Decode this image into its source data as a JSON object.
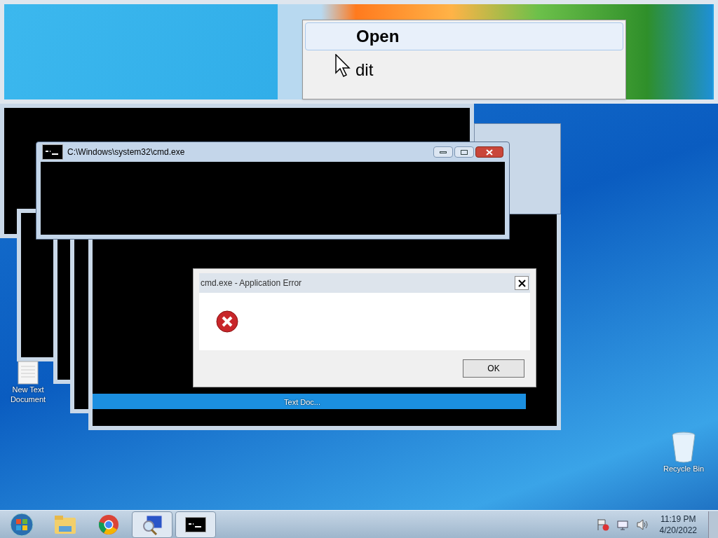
{
  "top_strip": {
    "menu": [
      {
        "label": "Open",
        "selected": true
      },
      {
        "label": "dit",
        "selected": false
      }
    ]
  },
  "cmd_window": {
    "title": "C:\\Windows\\system32\\cmd.exe"
  },
  "error_dialog": {
    "title": "cmd.exe - Application Error",
    "buttons": [
      "OK"
    ]
  },
  "desktop_icons": [
    {
      "kind": "text_file",
      "label": "New Text Document"
    },
    {
      "kind": "label_only",
      "label": "Text Doc..."
    },
    {
      "kind": "recycle_bin",
      "label": "Recycle Bin"
    }
  ],
  "taskbar": {
    "items": [
      {
        "kind": "start",
        "open": false
      },
      {
        "kind": "folder",
        "open": false
      },
      {
        "kind": "browser",
        "open": false
      },
      {
        "kind": "magnifier",
        "open": true
      },
      {
        "kind": "console",
        "open": true
      }
    ]
  },
  "clock": {
    "time": "11:19 PM",
    "date": "4/20/2022"
  }
}
